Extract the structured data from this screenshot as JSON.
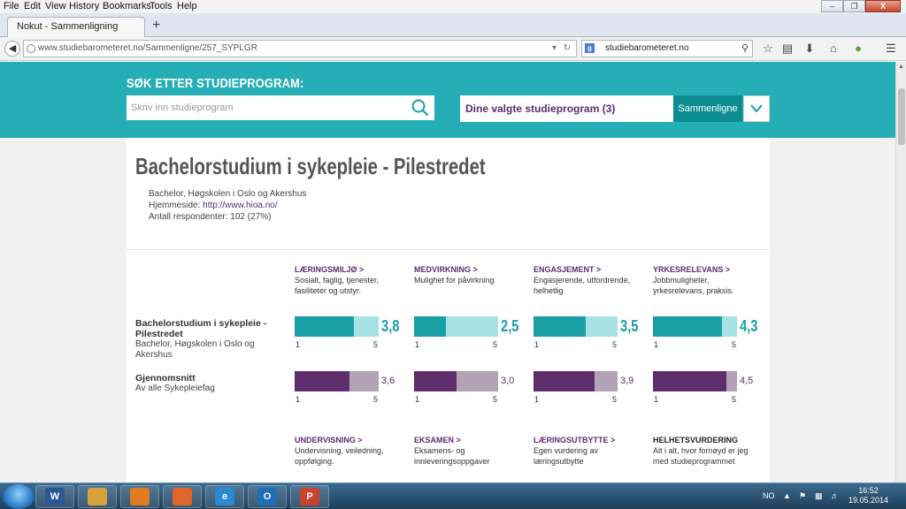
{
  "browser": {
    "menu": [
      "File",
      "Edit",
      "View",
      "History",
      "Bookmarks",
      "Tools",
      "Help"
    ],
    "tab_title": "Nokut - Sammenligning",
    "new_tab": "+",
    "url": "www.studiebarometeret.no/Sammenligne/257_SYPLGR",
    "search_engine_value": "studiebarometeret.no",
    "window_controls": [
      "–",
      "❐",
      "X"
    ]
  },
  "hero": {
    "title": "SØK ETTER STUDIEPROGRAM:",
    "search_placeholder": "Skriv inn studieprogram",
    "selected_label": "Dine valgte studieprogram (3)",
    "compare_button": "Sammenligne"
  },
  "program": {
    "title": "Bachelorstudium i sykepleie - Pilestredet",
    "degree_line": "Bachelor, Høgskolen i Oslo og Akershus",
    "homepage_label": "Hjemmeside:",
    "homepage_url": "http://www.hioa.no/",
    "respondents": "Antall respondenter: 102 (27%)"
  },
  "categories": [
    {
      "title": "LÆRINGSMILJØ >",
      "desc": "Sosialt, faglig, tjenester, fasiliteter og utstyr."
    },
    {
      "title": "MEDVIRKNING >",
      "desc": "Mulighet for påvirkning"
    },
    {
      "title": "ENGASJEMENT >",
      "desc": "Engasjerende, utfordrende, helhetlig"
    },
    {
      "title": "YRKESRELEVANS >",
      "desc": "Jobbmuligheter, yrkesrelevans, praksis."
    }
  ],
  "rows": [
    {
      "name": "Bachelorstudium i sykepleie - Pilestredet",
      "sub": "Bachelor, Høgskolen i Oslo og Akershus",
      "style": "teal",
      "scores": [
        3.8,
        2.5,
        3.5,
        4.3
      ],
      "labels": [
        "3,8",
        "2,5",
        "3,5",
        "4,3"
      ]
    },
    {
      "name": "Gjennomsnitt",
      "sub": "Av alle Sykepleiefag",
      "style": "purple",
      "scores": [
        3.6,
        3.0,
        3.9,
        4.5
      ],
      "labels": [
        "3,6",
        "3,0",
        "3,9",
        "4,5"
      ]
    }
  ],
  "scale": {
    "min": "1",
    "max": "5",
    "min_value": 1,
    "max_value": 5
  },
  "categories2": [
    {
      "title": "UNDERVISNING >",
      "desc": "Undervisning, veiledning, oppfølging."
    },
    {
      "title": "EKSAMEN >",
      "desc": "Eksamens- og innleveringsoppgaver"
    },
    {
      "title": "LÆRINGSUTBYTTE >",
      "desc": "Egen vurdering av læringsutbytte"
    },
    {
      "title": "HELHETSVURDERING",
      "desc": "Alt i alt, hvor fornøyd er jeg med studieprogrammet"
    }
  ],
  "taskbar": {
    "apps": [
      "word-icon",
      "explorer-icon",
      "media-player-icon",
      "firefox-icon",
      "internet-explorer-icon",
      "outlook-icon",
      "powerpoint-icon"
    ],
    "app_labels": [
      "W",
      "",
      "",
      "",
      "e",
      "O",
      "P"
    ],
    "language": "NO",
    "time": "16:52",
    "date": "19.05.2014"
  },
  "colors": {
    "teal": "#26aeb6",
    "dark_teal": "#1a9fa5",
    "purple": "#5e2d6c",
    "light_teal": "#a6e1e5",
    "light_purple": "#b3a2b6"
  }
}
